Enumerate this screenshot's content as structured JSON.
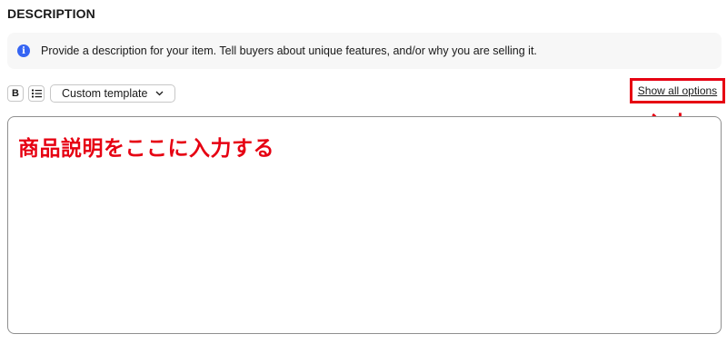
{
  "section": {
    "title": "DESCRIPTION"
  },
  "banner": {
    "icon": "info-icon",
    "icon_glyph": "i",
    "text": "Provide a description for your item. Tell buyers about unique features, and/or why you are selling it."
  },
  "toolbar": {
    "bold_label": "B",
    "bold_icon": "bold-icon",
    "list_icon": "bulleted-list-icon",
    "template_select": {
      "value": "Custom template",
      "icon": "chevron-down-icon"
    },
    "show_all_options": "Show all options"
  },
  "annotations": {
    "html_input": "HTML入力↑",
    "editor_hint": "商品説明をここに入力する",
    "highlight_color": "#e60012"
  },
  "colors": {
    "accent_blue": "#3665f3",
    "banner_bg": "#f7f7f7",
    "text": "#191919"
  }
}
